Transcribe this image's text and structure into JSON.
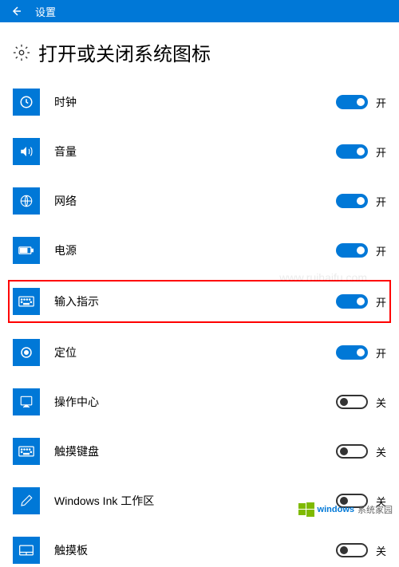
{
  "titlebar": {
    "label": "设置"
  },
  "page": {
    "title": "打开或关闭系统图标"
  },
  "toggle_labels": {
    "on": "开",
    "off": "关"
  },
  "items": [
    {
      "icon": "clock",
      "label": "时钟",
      "state": "on",
      "highlighted": false
    },
    {
      "icon": "volume",
      "label": "音量",
      "state": "on",
      "highlighted": false
    },
    {
      "icon": "network",
      "label": "网络",
      "state": "on",
      "highlighted": false
    },
    {
      "icon": "power",
      "label": "电源",
      "state": "on",
      "highlighted": false
    },
    {
      "icon": "keyboard",
      "label": "输入指示",
      "state": "on",
      "highlighted": true
    },
    {
      "icon": "location",
      "label": "定位",
      "state": "on",
      "highlighted": false
    },
    {
      "icon": "action-center",
      "label": "操作中心",
      "state": "off",
      "highlighted": false
    },
    {
      "icon": "touch-keyboard",
      "label": "触摸键盘",
      "state": "off",
      "highlighted": false
    },
    {
      "icon": "ink",
      "label": "Windows Ink 工作区",
      "state": "off",
      "highlighted": false
    },
    {
      "icon": "touchpad",
      "label": "触摸板",
      "state": "off",
      "highlighted": false
    }
  ],
  "watermark": {
    "brand": "windows",
    "sub": "系统家园",
    "url": "www.ruihaifu.com"
  }
}
